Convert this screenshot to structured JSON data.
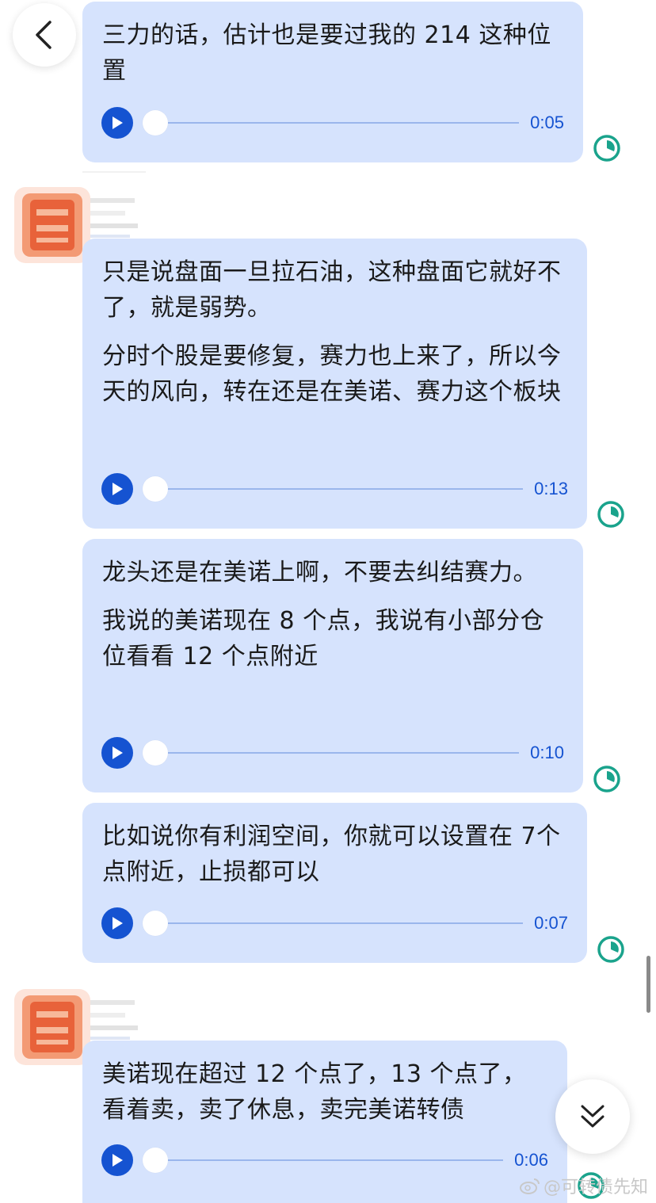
{
  "messages": [
    {
      "paragraphs": [
        "三力的话，估计也是要过我的 214 这种位置"
      ],
      "duration": "0:05"
    },
    {
      "paragraphs": [
        "只是说盘面一旦拉石油，这种盘面它就好不了，就是弱势。",
        "分时个股是要修复，赛力也上来了，所以今天的风向，转在还是在美诺、赛力这个板块"
      ],
      "duration": "0:13"
    },
    {
      "paragraphs": [
        "龙头还是在美诺上啊，不要去纠结赛力。",
        "我说的美诺现在 8 个点，我说有小部分仓位看看 12 个点附近"
      ],
      "duration": "0:10"
    },
    {
      "paragraphs": [
        "比如说你有利润空间，你就可以设置在 7个点附近，止损都可以"
      ],
      "duration": "0:07"
    },
    {
      "paragraphs": [
        "美诺现在超过 12 个点了，13 个点了，看着卖，卖了休息，卖完美诺转债"
      ],
      "duration": "0:06"
    }
  ],
  "icons": {
    "back": "chevron-left-icon",
    "play": "play-icon",
    "status": "clock-status-icon",
    "scroll": "double-chevron-down-icon"
  },
  "colors": {
    "bubble": "#d6e3fd",
    "accent": "#1553d1",
    "status": "#1aa38c"
  },
  "watermark": "@可转债先知"
}
